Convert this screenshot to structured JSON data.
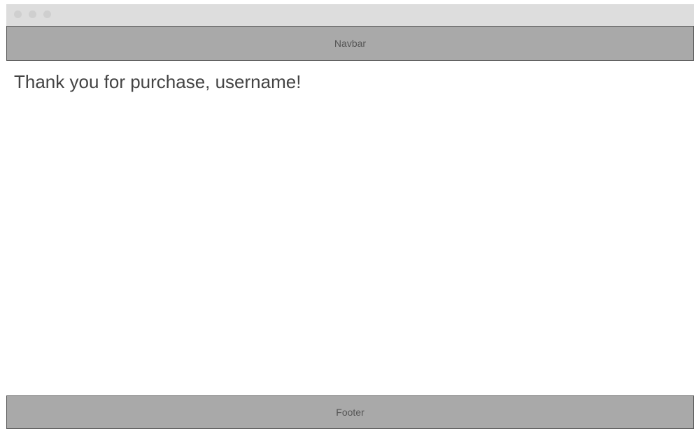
{
  "window": {
    "controls": [
      "window-dot-icon",
      "window-dot-icon",
      "window-dot-icon"
    ]
  },
  "navbar": {
    "label": "Navbar"
  },
  "main": {
    "heading": "Thank you for purchase, username!"
  },
  "footer": {
    "label": "Footer"
  },
  "colors": {
    "titlebar": "#dddddd",
    "bar_fill": "#a9a9a9",
    "bar_border": "#555555",
    "text": "#444444"
  }
}
